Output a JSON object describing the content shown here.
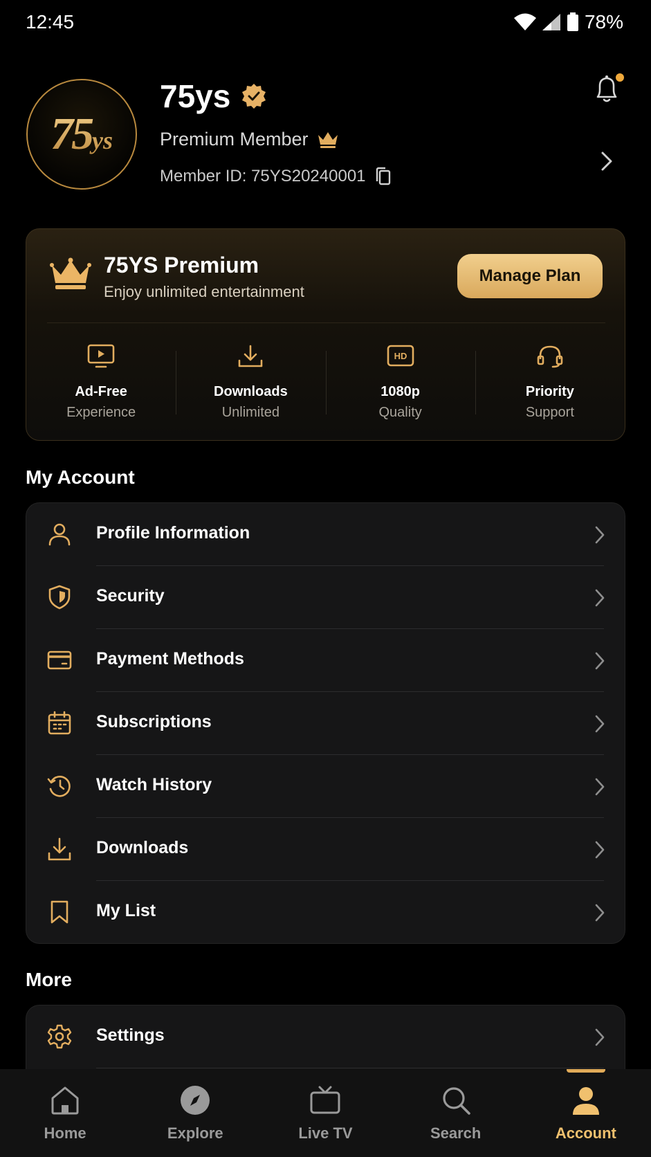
{
  "status_bar": {
    "time": "12:45",
    "battery": "78%"
  },
  "profile": {
    "avatar_text": "75",
    "avatar_text_small": "ys",
    "name": "75ys",
    "tier": "Premium Member",
    "member_id": "Member ID: 75YS20240001"
  },
  "premium": {
    "title": "75YS Premium",
    "subtitle": "Enjoy unlimited entertainment",
    "manage_label": "Manage Plan",
    "features": [
      {
        "title": "Ad-Free",
        "sub": "Experience",
        "icon": "tv-play-icon"
      },
      {
        "title": "Downloads",
        "sub": "Unlimited",
        "icon": "download-icon"
      },
      {
        "title": "1080p",
        "sub": "Quality",
        "icon": "hd-icon",
        "badge": "HD"
      },
      {
        "title": "Priority",
        "sub": "Support",
        "icon": "headset-icon"
      }
    ]
  },
  "my_account": {
    "title": "My Account",
    "items": [
      {
        "label": "Profile Information",
        "icon": "user-icon"
      },
      {
        "label": "Security",
        "icon": "shield-icon"
      },
      {
        "label": "Payment Methods",
        "icon": "credit-card-icon"
      },
      {
        "label": "Subscriptions",
        "icon": "calendar-icon"
      },
      {
        "label": "Watch History",
        "icon": "history-icon"
      },
      {
        "label": "Downloads",
        "icon": "download-icon"
      },
      {
        "label": "My List",
        "icon": "bookmark-icon"
      }
    ]
  },
  "more": {
    "title": "More",
    "items": [
      {
        "label": "Settings",
        "icon": "gear-icon"
      }
    ]
  },
  "nav": {
    "items": [
      {
        "label": "Home",
        "icon": "home-icon"
      },
      {
        "label": "Explore",
        "icon": "compass-icon"
      },
      {
        "label": "Live TV",
        "icon": "tv-icon"
      },
      {
        "label": "Search",
        "icon": "search-icon"
      },
      {
        "label": "Account",
        "icon": "account-icon",
        "active": true
      }
    ]
  },
  "colors": {
    "accent": "#e0aa58",
    "background": "#000000",
    "card": "#161617"
  }
}
